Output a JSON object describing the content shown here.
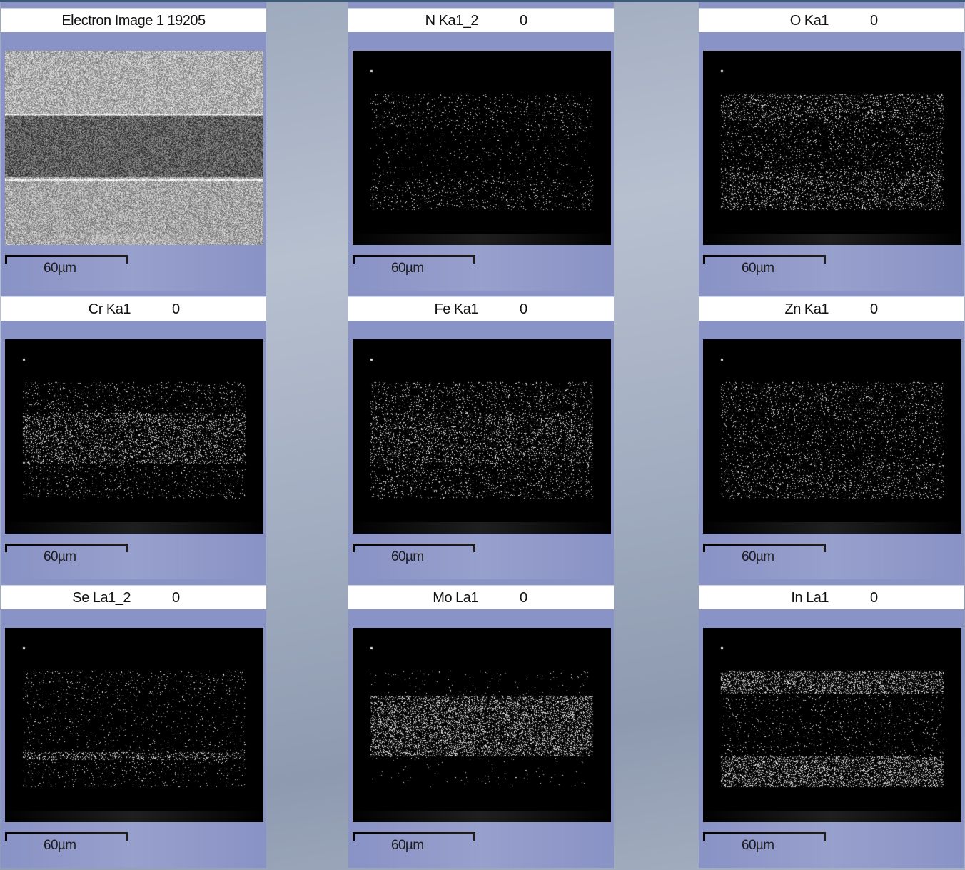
{
  "panels": [
    {
      "name": "Electron Image 1 19205",
      "count": "",
      "scale": "60µm",
      "kind": "electron",
      "bands": []
    },
    {
      "name": "N Ka1_2",
      "count": "0",
      "scale": "60µm",
      "kind": "map",
      "bands": [
        [
          0.22,
          0.4,
          0.12
        ],
        [
          0.4,
          0.66,
          0.05
        ],
        [
          0.66,
          0.82,
          0.14
        ]
      ]
    },
    {
      "name": "O Ka1",
      "count": "0",
      "scale": "60µm",
      "kind": "map",
      "bands": [
        [
          0.22,
          0.36,
          0.38
        ],
        [
          0.36,
          0.62,
          0.18
        ],
        [
          0.62,
          0.82,
          0.4
        ]
      ]
    },
    {
      "name": "Cr Ka1",
      "count": "0",
      "scale": "60µm",
      "kind": "map",
      "bands": [
        [
          0.22,
          0.38,
          0.14
        ],
        [
          0.38,
          0.64,
          0.48
        ],
        [
          0.64,
          0.82,
          0.12
        ]
      ]
    },
    {
      "name": "Fe Ka1",
      "count": "0",
      "scale": "60µm",
      "kind": "map",
      "bands": [
        [
          0.22,
          0.38,
          0.22
        ],
        [
          0.38,
          0.64,
          0.4
        ],
        [
          0.64,
          0.82,
          0.2
        ]
      ]
    },
    {
      "name": "Zn Ka1",
      "count": "0",
      "scale": "60µm",
      "kind": "map",
      "bands": [
        [
          0.22,
          0.38,
          0.22
        ],
        [
          0.38,
          0.64,
          0.16
        ],
        [
          0.64,
          0.82,
          0.24
        ]
      ]
    },
    {
      "name": "Se La1_2",
      "count": "0",
      "scale": "60µm",
      "kind": "map",
      "bands": [
        [
          0.22,
          0.34,
          0.1
        ],
        [
          0.34,
          0.64,
          0.06
        ],
        [
          0.64,
          0.68,
          0.55
        ],
        [
          0.68,
          0.82,
          0.08
        ]
      ]
    },
    {
      "name": "Mo La1",
      "count": "0",
      "scale": "60µm",
      "kind": "map",
      "bands": [
        [
          0.22,
          0.35,
          0.03
        ],
        [
          0.35,
          0.66,
          0.7
        ],
        [
          0.66,
          0.82,
          0.02
        ]
      ]
    },
    {
      "name": "In La1",
      "count": "0",
      "scale": "60µm",
      "kind": "map",
      "bands": [
        [
          0.22,
          0.34,
          0.7
        ],
        [
          0.34,
          0.66,
          0.08
        ],
        [
          0.66,
          0.82,
          0.72
        ]
      ]
    }
  ]
}
